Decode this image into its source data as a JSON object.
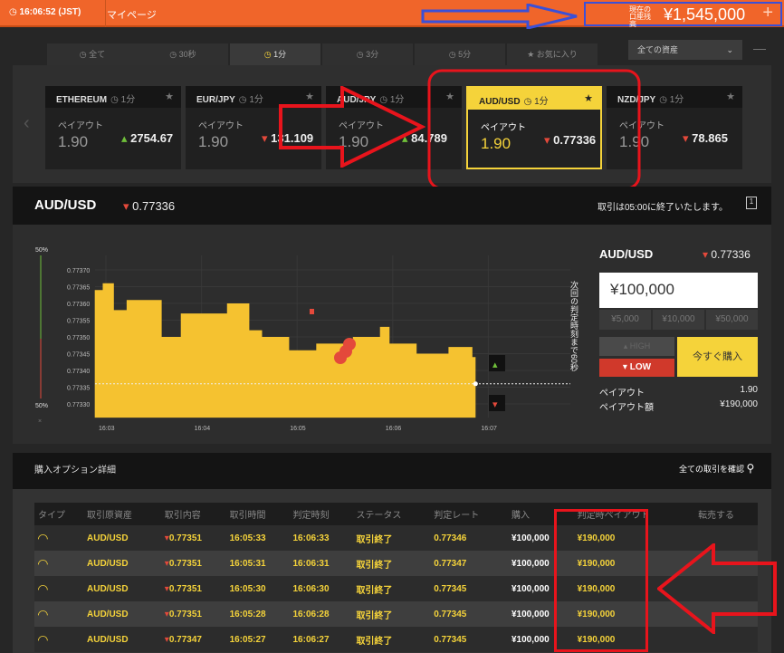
{
  "topbar": {
    "clock": "16:06:52 (JST)",
    "mypage": "マイページ",
    "balance_label": "現在の口座残高",
    "balance": "¥1,545,000",
    "plus": "+"
  },
  "tabs": [
    {
      "label": "全て",
      "icon": "clock-icon"
    },
    {
      "label": "30秒",
      "icon": "clock-icon"
    },
    {
      "label": "1分",
      "icon": "clock-icon",
      "active": true
    },
    {
      "label": "3分",
      "icon": "clock-icon"
    },
    {
      "label": "5分",
      "icon": "clock-icon"
    },
    {
      "label": "お気に入り",
      "icon": "star-icon"
    }
  ],
  "asset_select": {
    "value": "全ての資産"
  },
  "cards": [
    {
      "pair": "ETHEREUM",
      "time": "1分",
      "payout_label": "ペイアウト",
      "payout": "1.90",
      "rate": "2754.67",
      "dir": "up"
    },
    {
      "pair": "EUR/JPY",
      "time": "1分",
      "payout_label": "ペイアウト",
      "payout": "1.90",
      "rate": "131.109",
      "dir": "down"
    },
    {
      "pair": "AUD/JPY",
      "time": "1分",
      "payout_label": "ペイアウト",
      "payout": "1.90",
      "rate": "84.789",
      "dir": "up"
    },
    {
      "pair": "AUD/USD",
      "time": "1分",
      "payout_label": "ペイアウト",
      "payout": "1.90",
      "rate": "0.77336",
      "dir": "down",
      "selected": true
    },
    {
      "pair": "NZD/JPY",
      "time": "1分",
      "payout_label": "ペイアウト",
      "payout": "1.90",
      "rate": "78.865",
      "dir": "down"
    }
  ],
  "chart_header": {
    "pair": "AUD/USD",
    "rate": "0.77336",
    "note": "取引は05:00に終了いたします。"
  },
  "chart_data": {
    "type": "area",
    "sentiment_top": "50%",
    "sentiment_bottom": "50%",
    "vertical_note": "次回の判定時刻まで60秒",
    "y_ticks": [
      "0.77370",
      "0.77365",
      "0.77360",
      "0.77355",
      "0.77350",
      "0.77345",
      "0.77340",
      "0.77335",
      "0.77330"
    ],
    "x_ticks": [
      "16:03",
      "16:04",
      "16:05",
      "16:06",
      "16:07"
    ],
    "ylim": [
      0.77327,
      0.77372
    ],
    "current_rate": 0.77336,
    "x": [
      "16:02:53",
      "16:02:58",
      "16:03:05",
      "16:03:10",
      "16:03:13",
      "16:03:27",
      "16:03:35",
      "16:03:44",
      "16:03:47",
      "16:04:04",
      "16:04:16",
      "16:04:22",
      "16:04:30",
      "16:04:38",
      "16:04:53",
      "16:04:55",
      "16:05:10",
      "16:05:12",
      "16:05:29",
      "16:05:35",
      "16:05:46",
      "16:05:52",
      "16:05:58",
      "16:06:15",
      "16:06:32",
      "16:06:35",
      "16:06:46",
      "16:06:50",
      "16:06:52"
    ],
    "y": [
      0.77364,
      0.77366,
      0.77358,
      0.77358,
      0.77361,
      0.77361,
      0.7735,
      0.7735,
      0.77357,
      0.77357,
      0.7736,
      0.7736,
      0.77352,
      0.7735,
      0.7735,
      0.77346,
      0.77346,
      0.77348,
      0.77348,
      0.7735,
      0.7735,
      0.77353,
      0.77348,
      0.77345,
      0.77345,
      0.77347,
      0.77347,
      0.77344,
      0.77336
    ],
    "color": "#f5c230"
  },
  "trade_panel": {
    "pair": "AUD/USD",
    "rate": "0.77336",
    "amount": "¥100,000",
    "quick": [
      "¥5,000",
      "¥10,000",
      "¥50,000"
    ],
    "high": "HIGH",
    "low": "LOW",
    "buy": "今すぐ購入",
    "payout_label": "ペイアウト",
    "payout": "1.90",
    "payout_amount_label": "ペイアウト額",
    "payout_amount": "¥190,000"
  },
  "section": {
    "title": "購入オプション詳細",
    "link": "全ての取引を確認"
  },
  "table": {
    "headers": [
      "タイプ",
      "取引原資産",
      "取引内容",
      "取引時間",
      "判定時刻",
      "ステータス",
      "判定レート",
      "購入",
      "判定時ペイアウト",
      "転売する"
    ],
    "rows": [
      [
        "AUD/USD",
        "0.77351",
        "16:05:33",
        "16:06:33",
        "取引終了",
        "0.77346",
        "¥100,000",
        "¥190,000"
      ],
      [
        "AUD/USD",
        "0.77351",
        "16:05:31",
        "16:06:31",
        "取引終了",
        "0.77347",
        "¥100,000",
        "¥190,000"
      ],
      [
        "AUD/USD",
        "0.77351",
        "16:05:30",
        "16:06:30",
        "取引終了",
        "0.77345",
        "¥100,000",
        "¥190,000"
      ],
      [
        "AUD/USD",
        "0.77351",
        "16:05:28",
        "16:06:28",
        "取引終了",
        "0.77345",
        "¥100,000",
        "¥190,000"
      ],
      [
        "AUD/USD",
        "0.77347",
        "16:05:27",
        "16:06:27",
        "取引終了",
        "0.77345",
        "¥100,000",
        "¥190,000"
      ]
    ]
  }
}
